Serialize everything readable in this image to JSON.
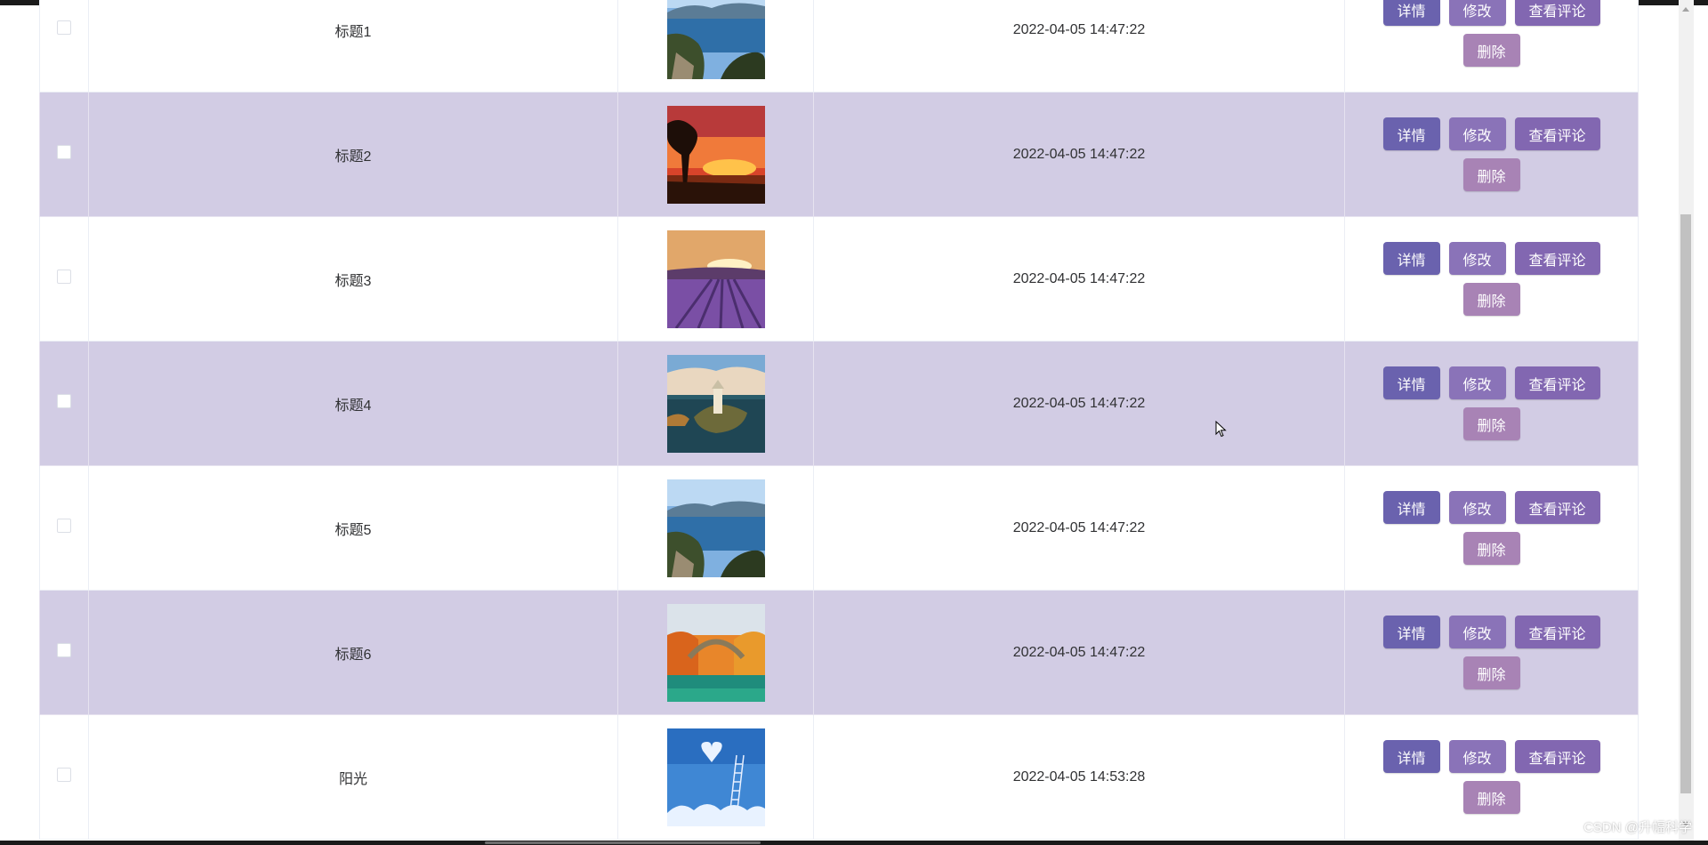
{
  "table": {
    "rows": [
      {
        "title": "标题1",
        "time": "2022-04-05 14:47:22",
        "image": "lake-island-photo",
        "alt": false
      },
      {
        "title": "标题2",
        "time": "2022-04-05 14:47:22",
        "image": "sunset-tree-photo",
        "alt": true
      },
      {
        "title": "标题3",
        "time": "2022-04-05 14:47:22",
        "image": "lavender-field-photo",
        "alt": false
      },
      {
        "title": "标题4",
        "time": "2022-04-05 14:47:22",
        "image": "island-castle-photo",
        "alt": true
      },
      {
        "title": "标题5",
        "time": "2022-04-05 14:47:22",
        "image": "lake-island-photo",
        "alt": false
      },
      {
        "title": "标题6",
        "time": "2022-04-05 14:47:22",
        "image": "autumn-bridge-photo",
        "alt": true
      },
      {
        "title": "阳光",
        "time": "2022-04-05 14:53:28",
        "image": "sky-heart-ladder-photo",
        "alt": false
      }
    ],
    "actions": {
      "detail": "详情",
      "edit": "修改",
      "comments": "查看评论",
      "delete": "删除"
    }
  },
  "colors": {
    "alt_row": "#d2cce4",
    "detail_button": "#6a62ae",
    "edit_button": "#8a73b8",
    "comment_button": "#8267b1",
    "delete_button": "#a883b5"
  },
  "watermark": "CSDN @升幅科学"
}
